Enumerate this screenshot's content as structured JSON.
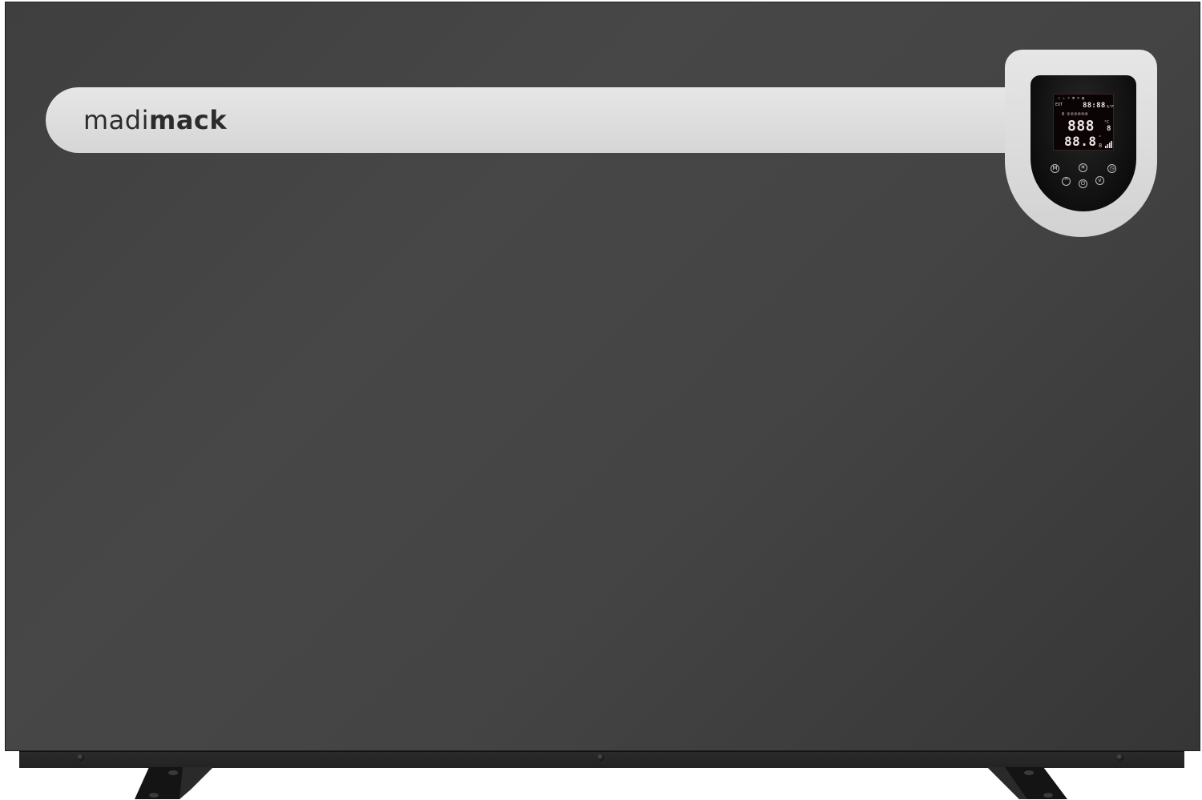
{
  "brand": {
    "logo_light": "madi",
    "logo_bold": "mack"
  },
  "display": {
    "top_icons": "◌ ▵ ☼ ❄ ▽ ◍",
    "ext_label": "EXT",
    "clock": "88:88",
    "unit_small": "%°F",
    "mode_row": "8 ①②③④⑤⑥",
    "main_digits": "888",
    "main_unit": "°C",
    "main_suffix": "8",
    "sub_digits": "88.8",
    "sub_unit": "°",
    "sub_suffix": "8"
  },
  "buttons": {
    "mode": "M",
    "sun": "☀",
    "clock": "◷",
    "up": "^",
    "power": "⏻",
    "down": "v"
  },
  "colors": {
    "body": "#444444",
    "strip": "#dcdcdc",
    "lcd_text": "#f2e4e4"
  }
}
